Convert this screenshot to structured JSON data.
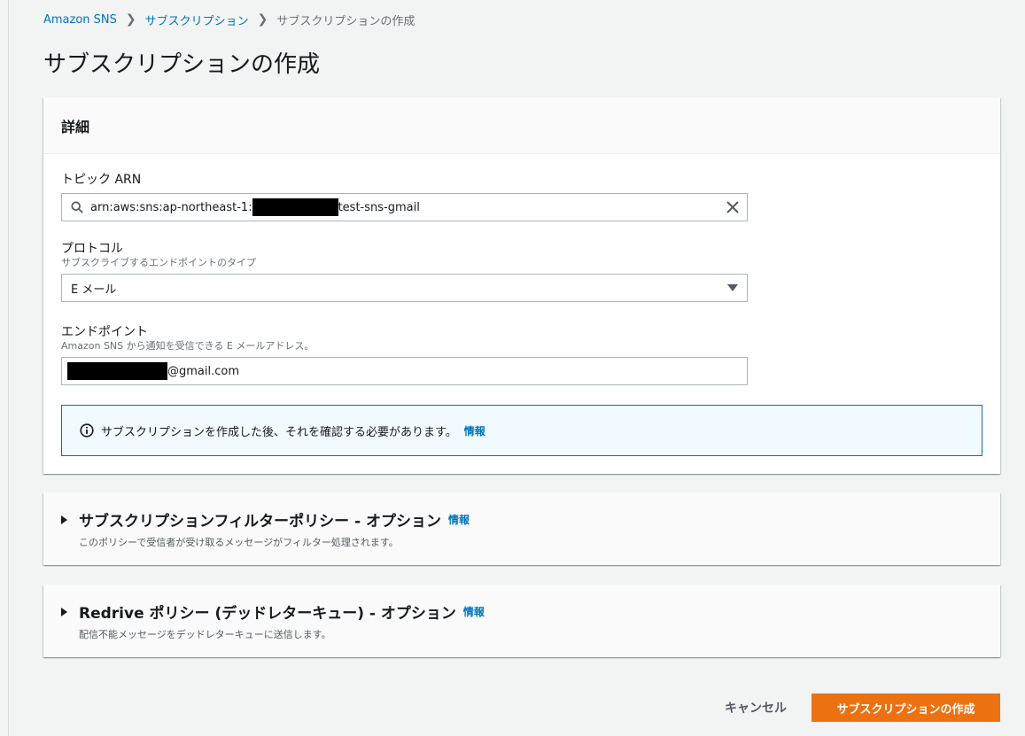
{
  "breadcrumb": {
    "items": [
      "Amazon SNS",
      "サブスクリプション"
    ],
    "current": "サブスクリプションの作成"
  },
  "page_title": "サブスクリプションの作成",
  "details": {
    "header": "詳細",
    "topic_arn": {
      "label": "トピック ARN",
      "value_prefix": "arn:aws:sns:ap-northeast-1:",
      "value_suffix": "test-sns-gmail"
    },
    "protocol": {
      "label": "プロトコル",
      "description": "サブスクライブするエンドポイントのタイプ",
      "selected": "E メール"
    },
    "endpoint": {
      "label": "エンドポイント",
      "description": "Amazon SNS から通知を受信できる E メールアドレス。",
      "value_suffix": "@gmail.com"
    },
    "info_message": "サブスクリプションを作成した後、それを確認する必要があります。",
    "info_link": "情報"
  },
  "filter_policy": {
    "title": "サブスクリプションフィルターポリシー - オプション",
    "info_link": "情報",
    "description": "このポリシーで受信者が受け取るメッセージがフィルター処理されます。"
  },
  "redrive_policy": {
    "title": "Redrive ポリシー (デッドレターキュー) - オプション",
    "info_link": "情報",
    "description": "配信不能メッセージをデッドレターキューに送信します。"
  },
  "actions": {
    "cancel": "キャンセル",
    "create": "サブスクリプションの作成"
  },
  "colors": {
    "accent": "#0073bb",
    "primary_button": "#ec7211"
  }
}
